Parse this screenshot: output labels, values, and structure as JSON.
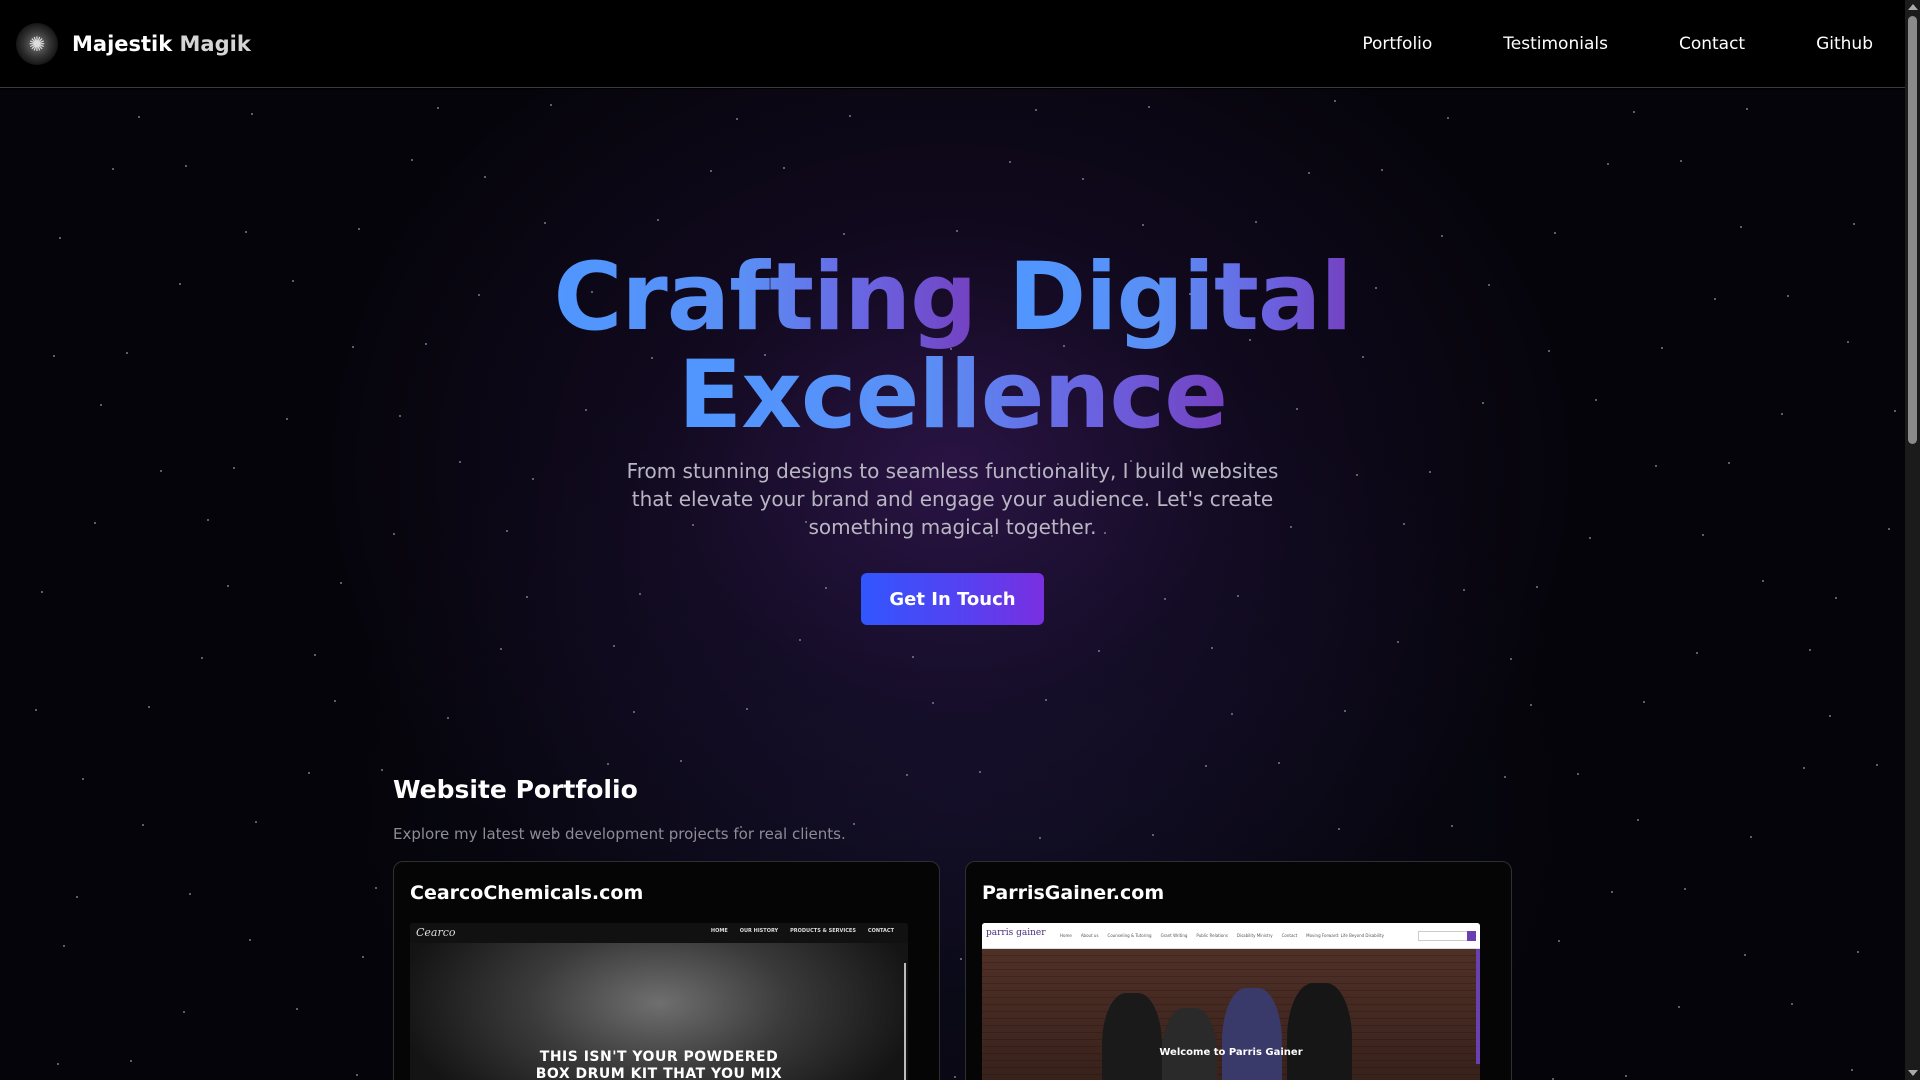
{
  "header": {
    "brand_first": "Majestik",
    "brand_second": "Magik",
    "nav": [
      {
        "label": "Portfolio"
      },
      {
        "label": "Testimonials"
      },
      {
        "label": "Contact"
      },
      {
        "label": "Github"
      }
    ]
  },
  "hero": {
    "title_line1_a": "Crafting",
    "title_line1_b": "Digital",
    "title_line2": "Excellence",
    "subtitle": "From stunning designs to seamless functionality, I build websites that elevate your brand and engage your audience. Let's create something magical together.",
    "cta_label": "Get In Touch"
  },
  "portfolio": {
    "title": "Website Portfolio",
    "subtitle": "Explore my latest web development projects for real clients.",
    "items": [
      {
        "title": "CearcoChemicals.com",
        "preview_logo": "Cearco",
        "preview_menu": [
          "HOME",
          "OUR HISTORY",
          "PRODUCTS & SERVICES",
          "CONTACT"
        ],
        "preview_headline_1": "THIS ISN'T YOUR POWDERED",
        "preview_headline_2": "BOX DRUM KIT THAT YOU MIX"
      },
      {
        "title": "ParrisGainer.com",
        "preview_logo": "parris gainer",
        "preview_menu": [
          "Home",
          "About us",
          "Counseling & Tutoring",
          "Grant Writing",
          "Public Relations",
          "Disability Ministry",
          "Contact",
          "Moving Forward: Life Beyond Disability"
        ],
        "preview_headline": "Welcome to Parris Gainer"
      }
    ]
  },
  "colors": {
    "accent_gradient_start": "#4f97ff",
    "accent_gradient_end": "#7440c0",
    "cta_start": "#3156ff",
    "cta_end": "#7a2fe0"
  }
}
